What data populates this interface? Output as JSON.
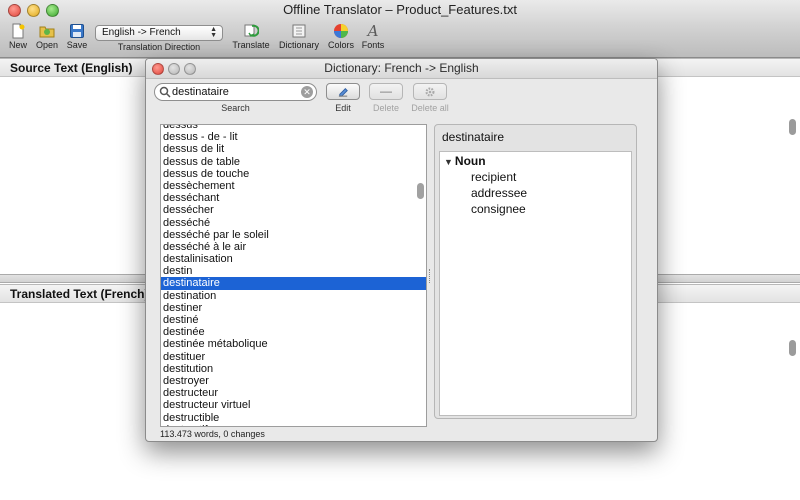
{
  "window": {
    "title": "Offline Translator – Product_Features.txt"
  },
  "toolbar": {
    "new": "New",
    "open": "Open",
    "save": "Save",
    "direction_value": "English -> French",
    "direction_label": "Translation Direction",
    "translate": "Translate",
    "dictionary": "Dictionary",
    "colors": "Colors",
    "fonts": "Fonts"
  },
  "source_pane": {
    "header": "Source Text (English)"
  },
  "translated_pane": {
    "header": "Translated Text (French)"
  },
  "dictionary": {
    "title": "Dictionary: French -> English",
    "search_value": "destinataire",
    "search_label": "Search",
    "edit_label": "Edit",
    "delete_label": "Delete",
    "delete_all_label": "Delete all",
    "add_symbol": "—",
    "words": [
      "dessus",
      "dessus - de - lit",
      "dessus de lit",
      "dessus de table",
      "dessus de touche",
      "dessèchement",
      "desséchant",
      "dessécher",
      "desséché",
      "desséché par le soleil",
      "desséché à le air",
      "destalinisation",
      "destin",
      "destinataire",
      "destination",
      "destiner",
      "destiné",
      "destinée",
      "destinée métabolique",
      "destituer",
      "destitution",
      "destroyer",
      "destructeur",
      "destructeur virtuel",
      "destructible",
      "destructif"
    ],
    "selected_index": 13,
    "entry": {
      "headword": "destinataire",
      "part_of_speech": "Noun",
      "translations": [
        "recipient",
        "addressee",
        "consignee"
      ]
    },
    "status": "113.473 words, 0 changes"
  },
  "colors": {
    "selection": "#1c63d5",
    "close": "#e0443a",
    "minimize": "#e0a91c",
    "zoom": "#3aa62d"
  }
}
